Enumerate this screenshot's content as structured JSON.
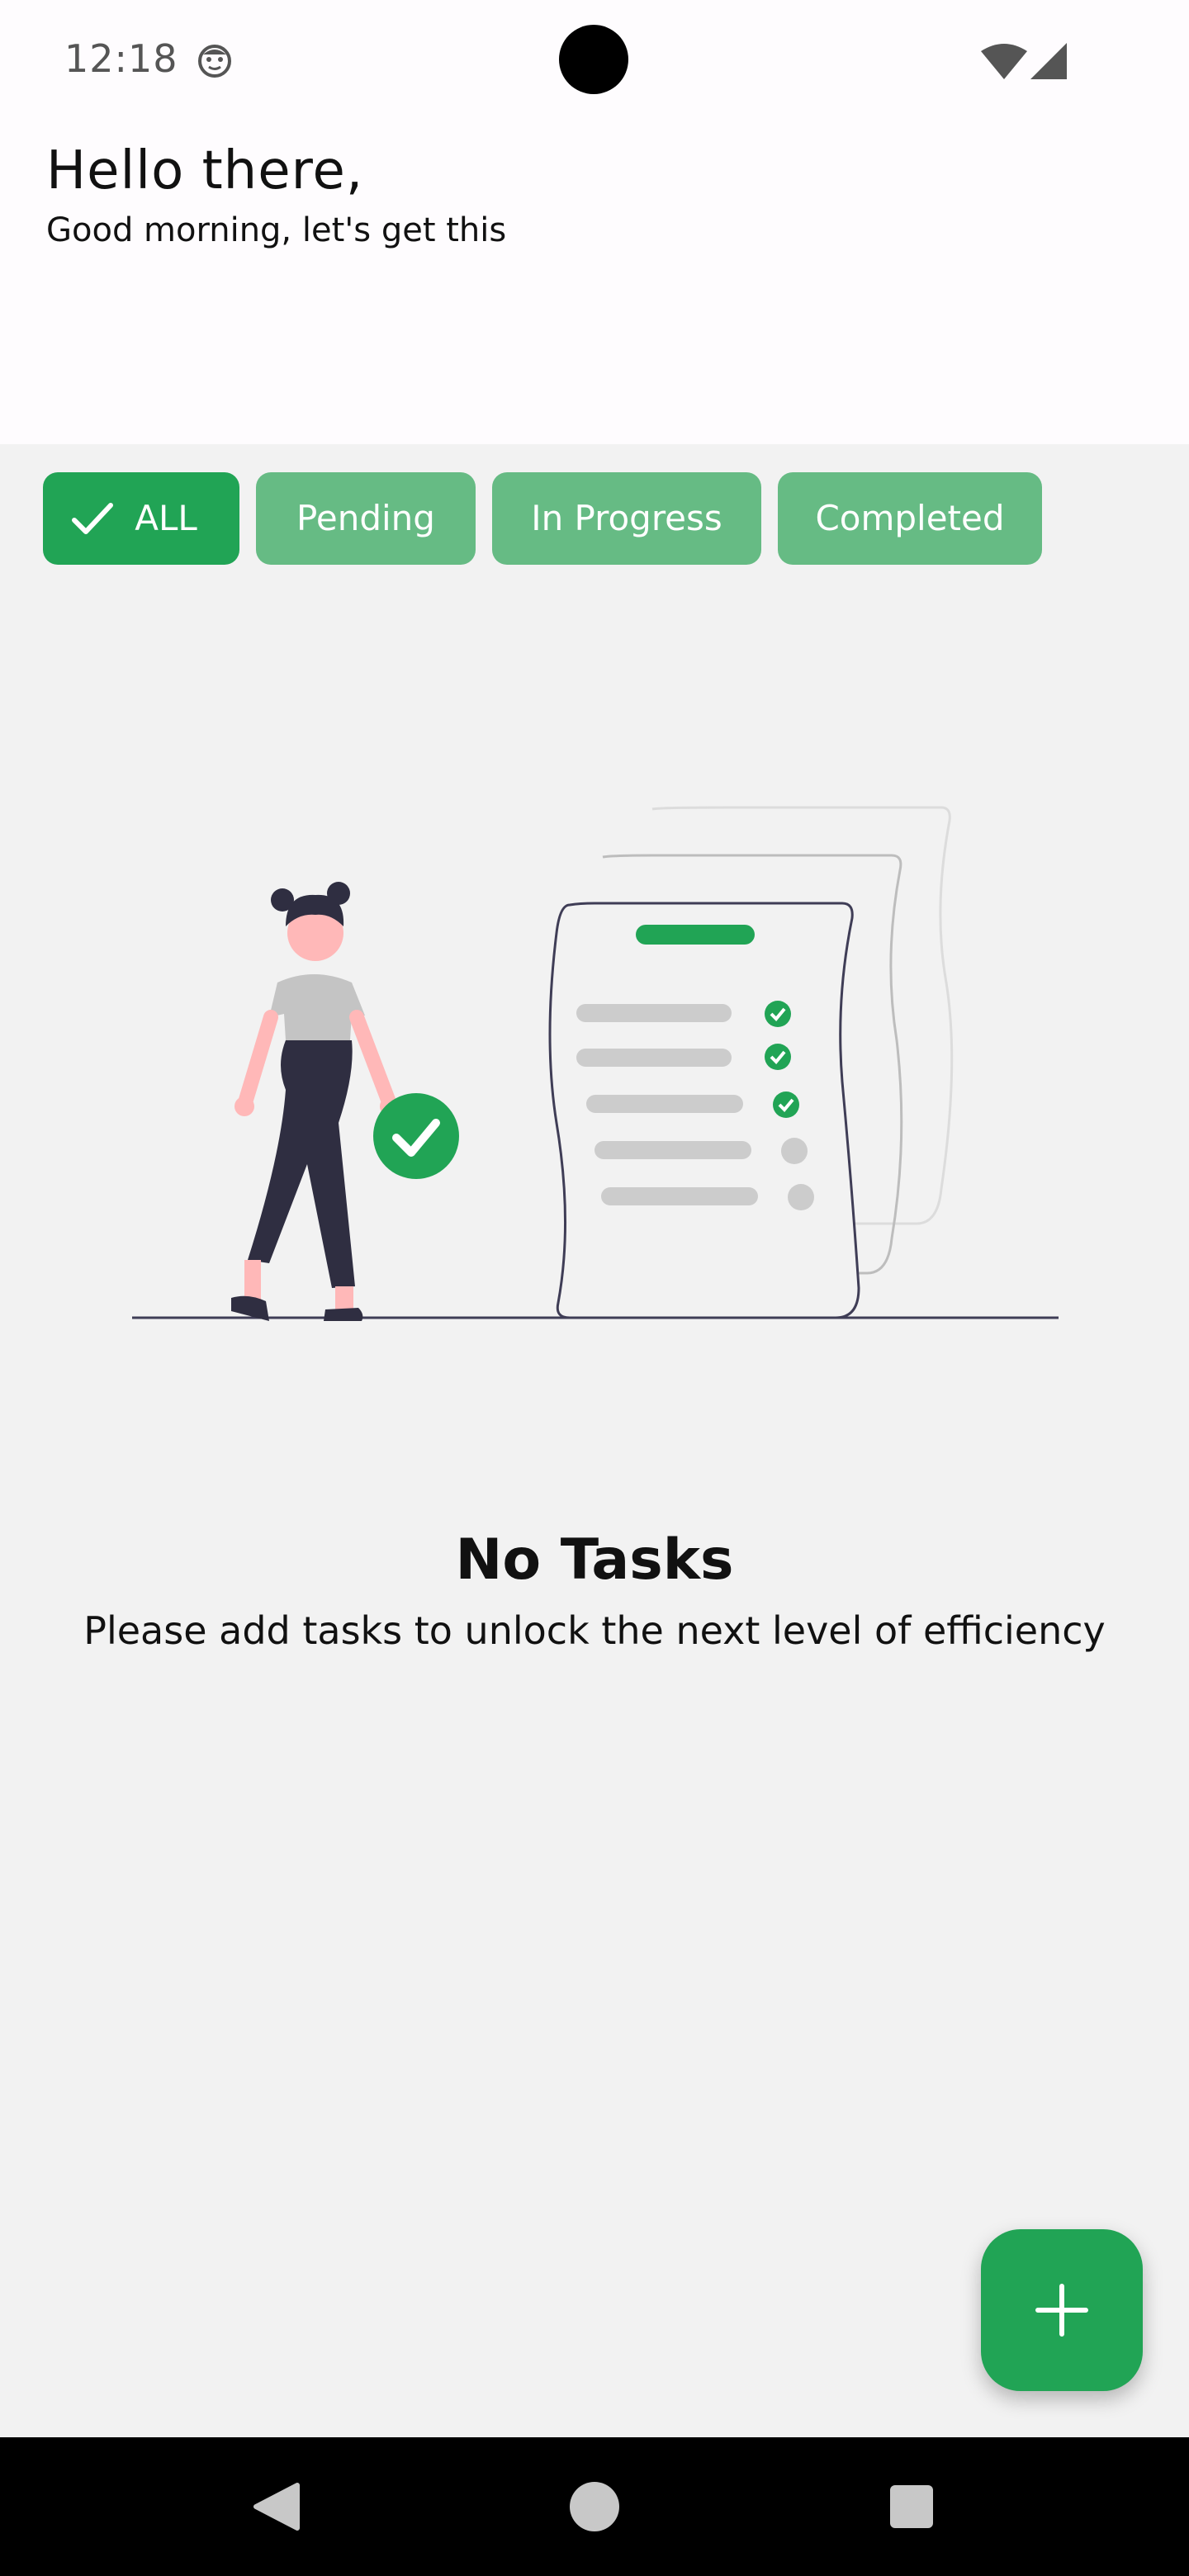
{
  "status_bar": {
    "time": "12:18",
    "icons": [
      "face-icon",
      "wifi-icon",
      "signal-icon"
    ]
  },
  "header": {
    "greeting": "Hello there,",
    "subtitle": "Good morning, let's get this"
  },
  "filters": {
    "items": [
      {
        "label": "ALL",
        "selected": true
      },
      {
        "label": "Pending",
        "selected": false
      },
      {
        "label": "In Progress",
        "selected": false
      },
      {
        "label": "Completed",
        "selected": false
      }
    ]
  },
  "empty_state": {
    "title": "No Tasks",
    "description": "Please add tasks to unlock the next level of efficiency"
  },
  "fab": {
    "icon": "plus-icon"
  },
  "colors": {
    "accent": "#21a455",
    "chip_inactive": "#66bb84",
    "background": "#f2f2f2",
    "header_background": "#fefcfe"
  }
}
